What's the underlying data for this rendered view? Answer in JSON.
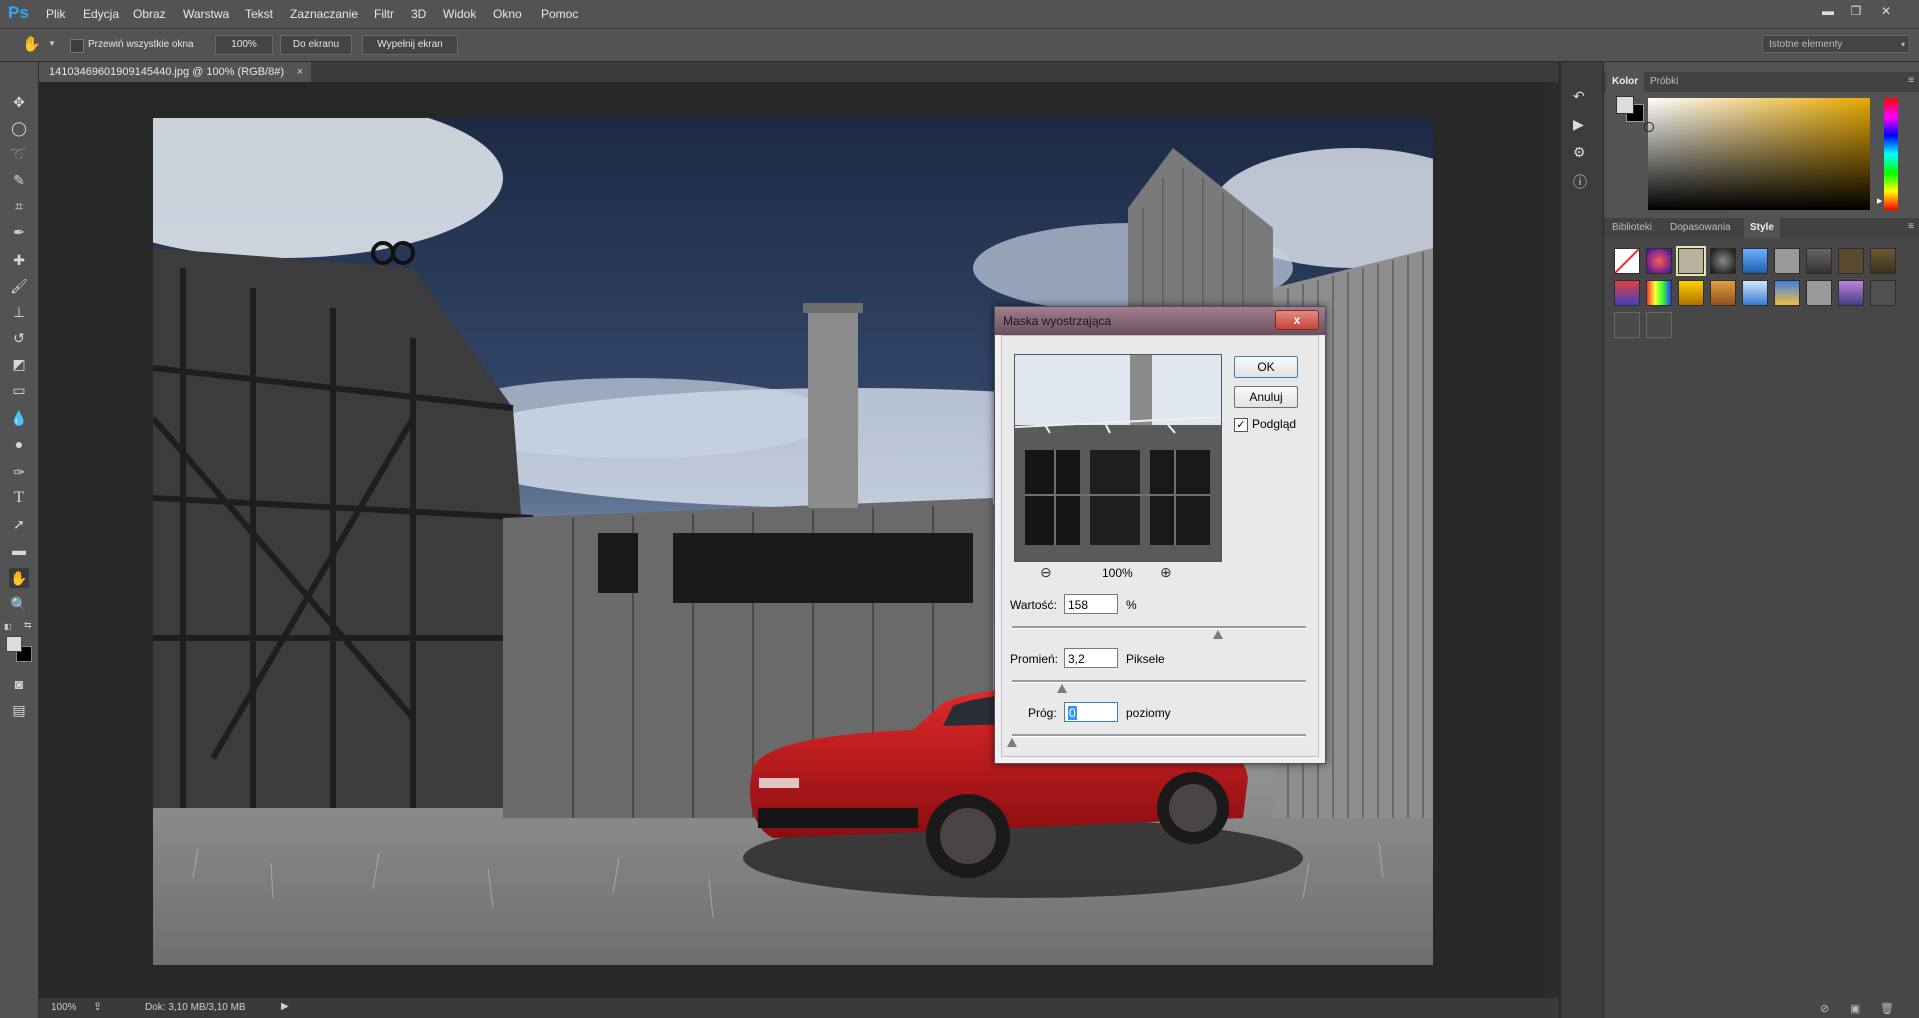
{
  "app": {
    "logo": "Ps"
  },
  "menu": [
    "Plik",
    "Edycja",
    "Obraz",
    "Warstwa",
    "Tekst",
    "Zaznaczanie",
    "Filtr",
    "3D",
    "Widok",
    "Okno",
    "Pomoc"
  ],
  "options": {
    "scroll_all_label": "Przewiń wszystkie okna",
    "zoom100": "100%",
    "fit_screen": "Do ekranu",
    "fill_screen": "Wypełnij ekran",
    "workspace": "Istotne elementy"
  },
  "document": {
    "tab_title": "14103469601909145440.jpg @ 100% (RGB/8#)",
    "tab_close": "×"
  },
  "status": {
    "zoom": "100%",
    "doc_info": "Dok: 3,10 MB/3,10 MB"
  },
  "panels": {
    "color_tabs": [
      "Kolor",
      "Próbki"
    ],
    "style_tabs": [
      "Biblioteki",
      "Dopasowania",
      "Style"
    ]
  },
  "dialog": {
    "title": "Maska wyostrzająca",
    "close": "x",
    "ok": "OK",
    "cancel": "Anuluj",
    "preview_label": "Podgląd",
    "preview_checked": true,
    "zoom_level": "100%",
    "amount_label": "Wartość:",
    "amount_value": "158",
    "amount_unit": "%",
    "radius_label": "Promień:",
    "radius_value": "3,2",
    "radius_unit": "Piksele",
    "threshold_label": "Próg:",
    "threshold_value": "0",
    "threshold_unit": "poziomy",
    "amount_slider_fraction": 0.7,
    "radius_slider_fraction": 0.17,
    "threshold_slider_fraction": 0.0
  },
  "colors": {
    "accent_ps": "#31a8ff",
    "ui_panel": "#535353",
    "car_red": "#c8161c"
  }
}
